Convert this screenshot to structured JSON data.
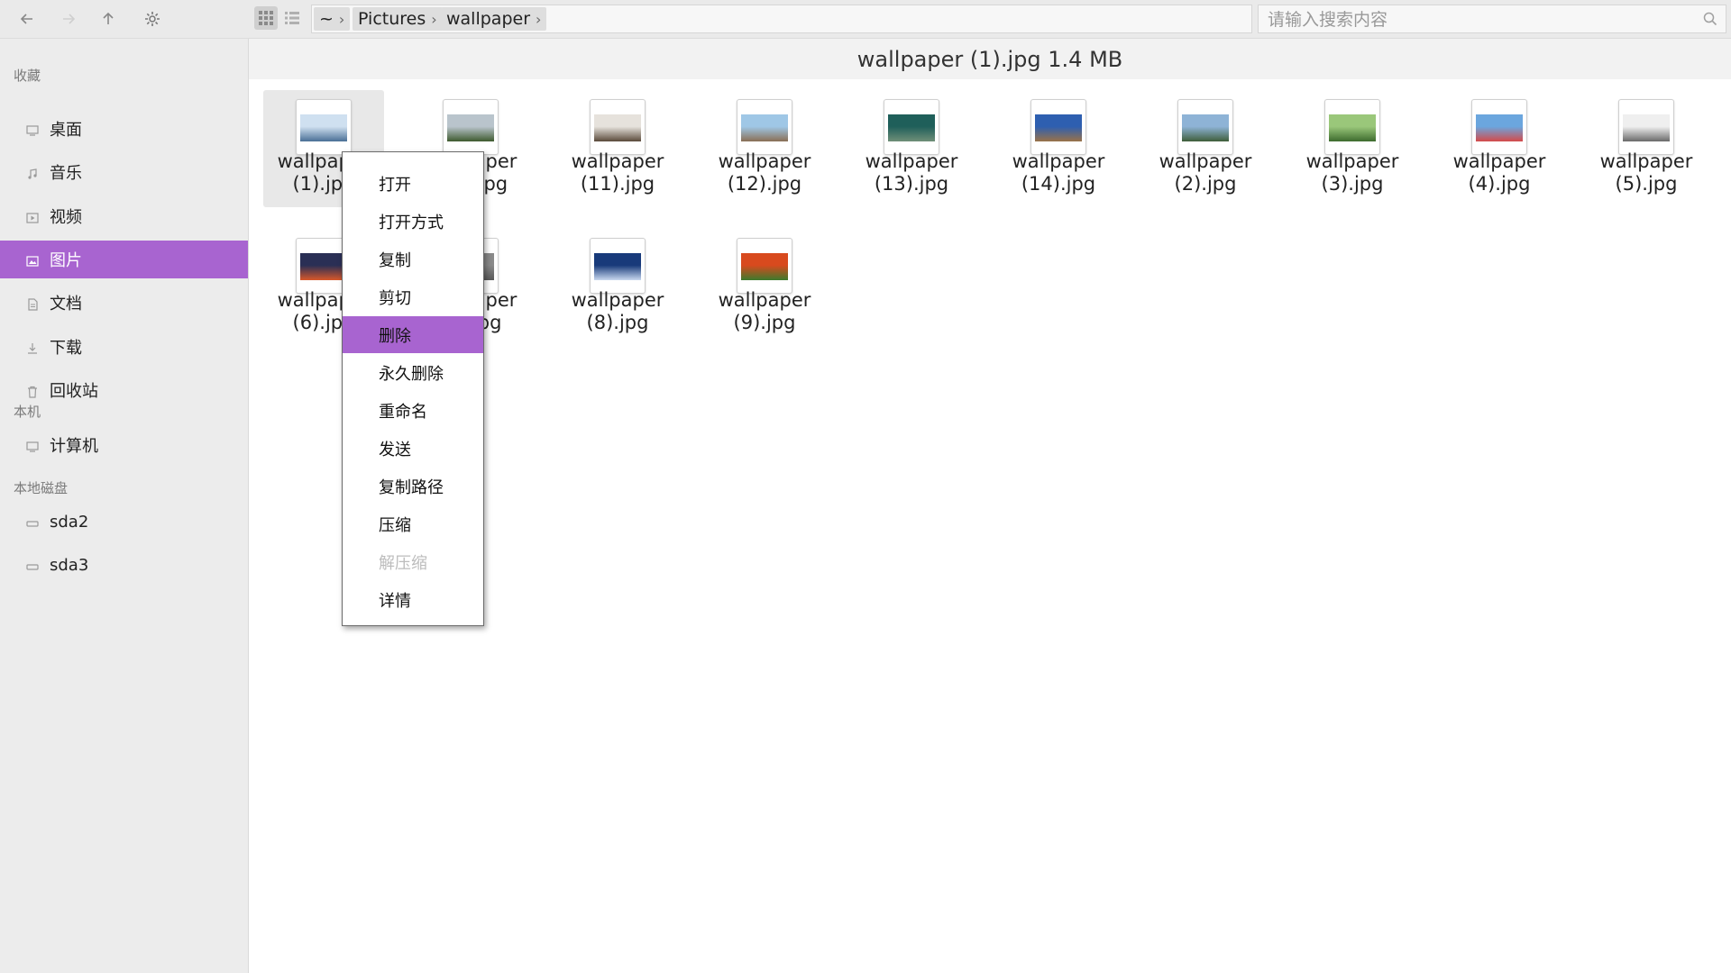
{
  "toolbar": {
    "back_icon": "arrow-left-icon",
    "forward_icon": "arrow-right-icon",
    "up_icon": "arrow-up-icon",
    "settings_icon": "gear-icon",
    "grid_view_icon": "grid-view-icon",
    "list_view_icon": "list-view-icon"
  },
  "breadcrumb": [
    {
      "label": "~"
    },
    {
      "label": "Pictures"
    },
    {
      "label": "wallpaper"
    }
  ],
  "search": {
    "placeholder": "请输入搜索内容",
    "value": ""
  },
  "sidebar": {
    "favorites_title": "收藏",
    "favorites": [
      {
        "label": "桌面",
        "icon": "desktop-icon"
      },
      {
        "label": "音乐",
        "icon": "music-icon"
      },
      {
        "label": "视频",
        "icon": "video-icon"
      },
      {
        "label": "图片",
        "icon": "picture-icon",
        "selected": true
      },
      {
        "label": "文档",
        "icon": "document-icon"
      },
      {
        "label": "下载",
        "icon": "download-icon"
      },
      {
        "label": "回收站",
        "icon": "trash-icon"
      }
    ],
    "computer_title": "本机",
    "computer": [
      {
        "label": "计算机",
        "icon": "computer-icon"
      }
    ],
    "disks_title": "本地磁盘",
    "disks": [
      {
        "label": "sda2",
        "icon": "disk-icon"
      },
      {
        "label": "sda3",
        "icon": "disk-icon"
      }
    ]
  },
  "status": {
    "text": "wallpaper (1).jpg 1.4 MB"
  },
  "files": [
    {
      "line1": "wallpaper",
      "line2": "(1).jpg",
      "selected": true,
      "colors": [
        "#cfe0f0",
        "#4a6f96"
      ]
    },
    {
      "line1": "wallpaper",
      "line2": "(10).jpg",
      "colors": [
        "#b9c4cc",
        "#3e5a2e"
      ]
    },
    {
      "line1": "wallpaper",
      "line2": "(11).jpg",
      "colors": [
        "#e6e2dc",
        "#5a4a3a"
      ]
    },
    {
      "line1": "wallpaper",
      "line2": "(12).jpg",
      "colors": [
        "#9fc7e6",
        "#8a6f55"
      ]
    },
    {
      "line1": "wallpaper",
      "line2": "(13).jpg",
      "colors": [
        "#1f5f5a",
        "#6f8f78"
      ]
    },
    {
      "line1": "wallpaper",
      "line2": "(14).jpg",
      "colors": [
        "#2e5fb0",
        "#9a7248"
      ]
    },
    {
      "line1": "wallpaper",
      "line2": "(2).jpg",
      "colors": [
        "#8eb3d6",
        "#3f5e3a"
      ]
    },
    {
      "line1": "wallpaper",
      "line2": "(3).jpg",
      "colors": [
        "#9ac77a",
        "#3d6b2e"
      ]
    },
    {
      "line1": "wallpaper",
      "line2": "(4).jpg",
      "colors": [
        "#6ba6de",
        "#d44a4a"
      ]
    },
    {
      "line1": "wallpaper",
      "line2": "(5).jpg",
      "colors": [
        "#efefef",
        "#6a6a6a"
      ]
    },
    {
      "line1": "wallpaper",
      "line2": "(6).jpg",
      "colors": [
        "#2a2f55",
        "#d8582a"
      ]
    },
    {
      "line1": "wallpaper",
      "line2": "(7).jpg",
      "colors": [
        "#8a8a8a",
        "#5a5a5a"
      ]
    },
    {
      "line1": "wallpaper",
      "line2": "(8).jpg",
      "colors": [
        "#183a7a",
        "#c9d8ef"
      ]
    },
    {
      "line1": "wallpaper",
      "line2": "(9).jpg",
      "colors": [
        "#d84a1e",
        "#3c7a2c"
      ]
    }
  ],
  "context_menu": [
    {
      "label": "打开"
    },
    {
      "label": "打开方式"
    },
    {
      "label": "复制"
    },
    {
      "label": "剪切"
    },
    {
      "label": "删除",
      "hover": true
    },
    {
      "label": "永久删除"
    },
    {
      "label": "重命名"
    },
    {
      "label": "发送"
    },
    {
      "label": "复制路径"
    },
    {
      "label": "压缩"
    },
    {
      "label": "解压缩",
      "disabled": true
    },
    {
      "label": "详情"
    }
  ],
  "colors": {
    "accent": "#a864d0",
    "sidebar_bg": "#ececec",
    "toolbar_bg": "#eaeaea"
  }
}
